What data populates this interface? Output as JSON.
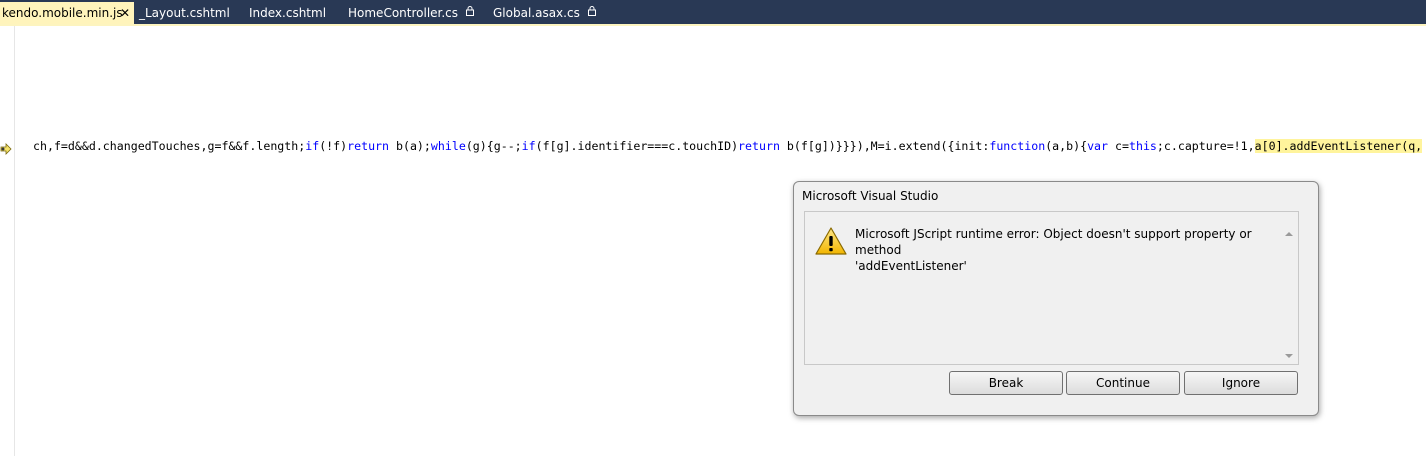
{
  "tabs": [
    {
      "label": "kendo.mobile.min.js",
      "active": true,
      "close_glyph": "✕"
    },
    {
      "label": "_Layout.cshtml",
      "active": false
    },
    {
      "label": "Index.cshtml",
      "active": false
    },
    {
      "label": "HomeController.cs",
      "active": false,
      "locked": true
    },
    {
      "label": "Global.asax.cs",
      "active": false,
      "locked": true
    }
  ],
  "editor": {
    "code": {
      "s1": "ch,f=d&&d.changedTouches,g=f&&f.length;",
      "k1": "if",
      "s2": "(!f)",
      "k2": "return",
      "s3": " b(a);",
      "k3": "while",
      "s4": "(g){g--;",
      "k4": "if",
      "s5": "(f[g].identifier===c.touchID)",
      "k5": "return",
      "s6": " b(f[g])}}}),M=i.extend({init:",
      "k6": "function",
      "s7": "(a,b){",
      "k7": "var",
      "s8": " c=",
      "k8": "this",
      "s9": ";c.capture=!1,",
      "hl": "a[0].addEventListener(q,"
    },
    "gutter_icon": "next-statement-arrow-icon"
  },
  "dialog": {
    "title": "Microsoft Visual Studio",
    "message_line1": "Microsoft JScript runtime error: Object doesn't support property or method",
    "message_line2": "'addEventListener'",
    "icon": "warning-icon",
    "buttons": {
      "break": "Break",
      "continue": "Continue",
      "ignore": "Ignore"
    }
  },
  "colors": {
    "tabbar_bg": "#293955",
    "active_tab_bg": "#fff4bc",
    "keyword": "#0000ff",
    "highlight": "#fff49c",
    "dialog_bg": "#f0f0f0"
  }
}
